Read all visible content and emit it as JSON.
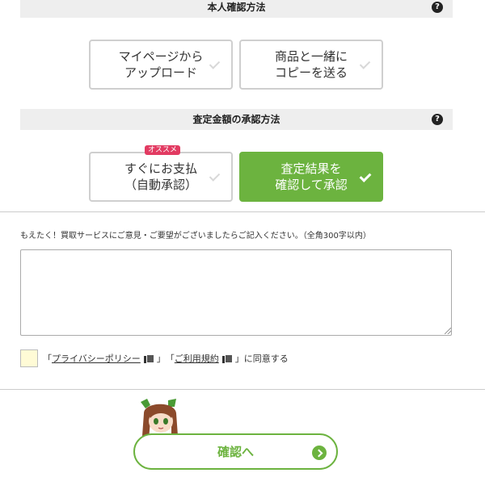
{
  "identity": {
    "header": "本人確認方法",
    "help": "?",
    "options": [
      {
        "line1": "マイページから",
        "line2": "アップロード"
      },
      {
        "line1": "商品と一緒に",
        "line2": "コピーを送る"
      }
    ]
  },
  "approval": {
    "header": "査定金額の承認方法",
    "help": "?",
    "badge": "オススメ",
    "options": [
      {
        "line1": "すぐにお支払",
        "line2": "（自動承認）"
      },
      {
        "line1": "査定結果を",
        "line2": "確認して承認"
      }
    ],
    "selected_index": 1
  },
  "comment": {
    "label": "もえたく！買取サービスにご意見・ご要望がございましたらご記入ください。（全角300字以内）",
    "value": ""
  },
  "agreement": {
    "open_quote1": "「",
    "privacy_link": "プライバシーポリシー",
    "close_quote1": "」",
    "open_quote2": "「",
    "terms_link": "ご利用規約",
    "close_quote2": "」",
    "suffix": "に同意する"
  },
  "confirm": {
    "label": "確認へ"
  },
  "colors": {
    "accent": "#6cb33f",
    "badge": "#e23b62",
    "checkbox_bg": "#fffbd6"
  }
}
